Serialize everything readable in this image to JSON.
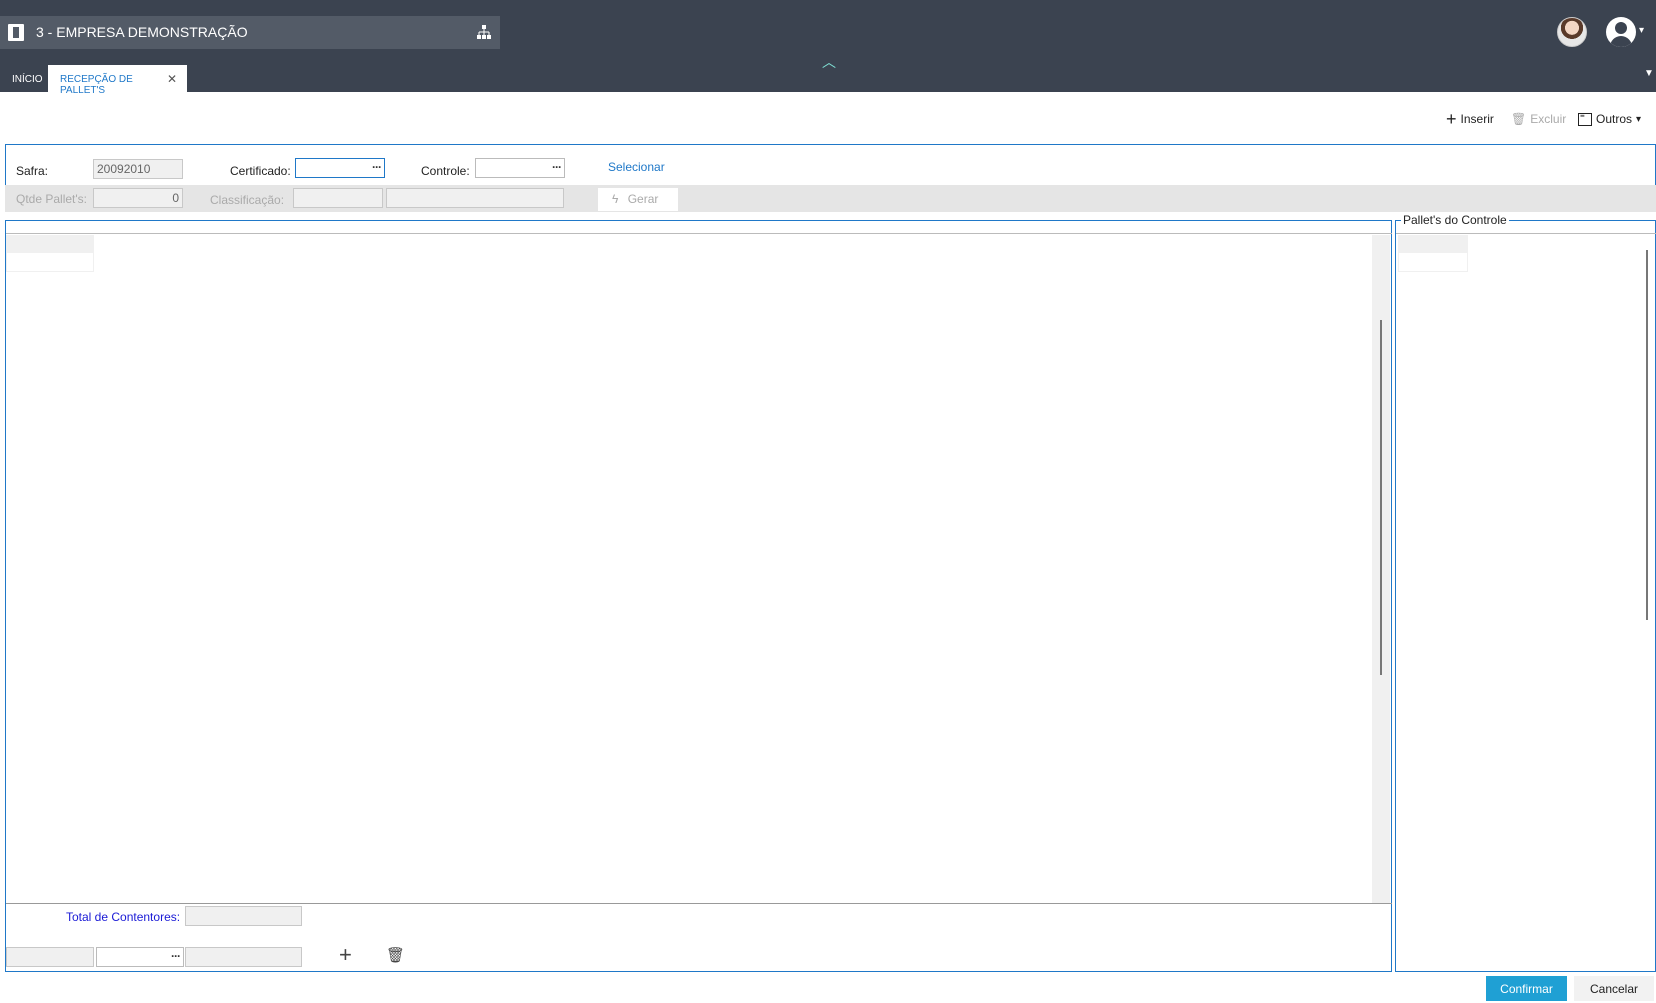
{
  "header": {
    "company_name": "3 - EMPRESA DEMONSTRAÇÃO",
    "company_icon": "building-icon",
    "org_icon": "org-chart-icon",
    "collapse_icon": "chevron-up-icon",
    "accent_color": "#7fe0d4"
  },
  "tabs": [
    {
      "label": "INÍCIO",
      "active": false
    },
    {
      "label": "RECEPÇÃO DE PALLET'S",
      "active": true,
      "close_icon": "close-icon"
    }
  ],
  "toolbar": {
    "insert_label": "Inserir",
    "delete_label": "Excluir",
    "others_label": "Outros"
  },
  "form": {
    "safra_label": "Safra:",
    "safra_value": "20092010",
    "certificado_label": "Certificado:",
    "certificado_value": "",
    "controle_label": "Controle:",
    "controle_value": "",
    "selecionar_label": "Selecionar",
    "qtde_label": "Qtde Pallet's:",
    "qtde_value": "0",
    "classificacao_label": "Classificação:",
    "gerar_label": "Gerar",
    "lookup_dots": "···"
  },
  "grid": {
    "total_label": "Total de Contentores:",
    "total_value": ""
  },
  "side_panel": {
    "title": "Pallet's do Controle"
  },
  "footer": {
    "confirm_label": "Confirmar",
    "cancel_label": "Cancelar"
  }
}
